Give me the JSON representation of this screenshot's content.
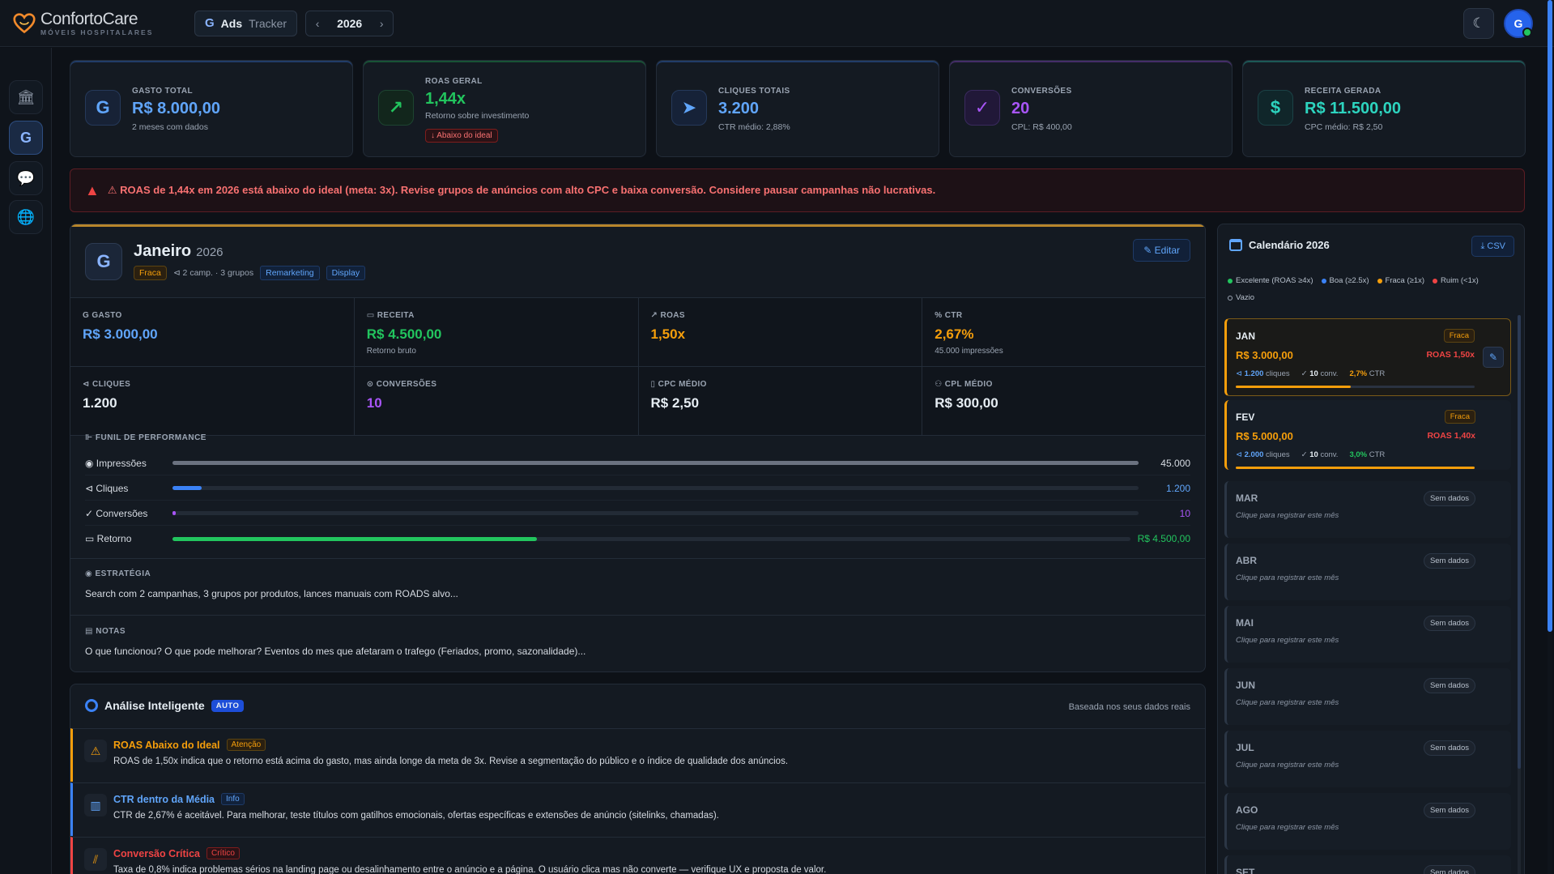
{
  "brand": {
    "name": "ConfortoCare",
    "sub": "MÓVEIS HOSPITALARES"
  },
  "app": {
    "g": "G",
    "ads": "Ads",
    "tracker": "Tracker"
  },
  "year_nav": {
    "prev": "‹",
    "year": "2026",
    "next": "›"
  },
  "user": {
    "initial": "G",
    "theme_icon": "☾"
  },
  "sidebar": {
    "items": [
      {
        "name": "hospital-icon",
        "glyph": "🏛",
        "active": false
      },
      {
        "name": "google-icon",
        "glyph": "G",
        "active": true
      },
      {
        "name": "chat-icon",
        "glyph": "💬",
        "active": false
      },
      {
        "name": "globe-icon",
        "glyph": "🌐",
        "active": false
      }
    ]
  },
  "kpis": [
    {
      "label": "GASTO TOTAL",
      "value": "R$ 8.000,00",
      "sub": "2 meses com dados",
      "icon": "G",
      "color": "#60a5fa"
    },
    {
      "label": "ROAS GERAL",
      "value": "1,44x",
      "sub": "Retorno sobre investimento",
      "badge": "↓ Abaixo do ideal",
      "icon": "↗",
      "color": "#22c55e"
    },
    {
      "label": "CLIQUES TOTAIS",
      "value": "3.200",
      "sub": "CTR médio: 2,88%",
      "icon": "➤",
      "color": "#60a5fa"
    },
    {
      "label": "CONVERSÕES",
      "value": "20",
      "sub": "CPL: R$ 400,00",
      "icon": "✓",
      "color": "#a855f7"
    },
    {
      "label": "RECEITA GERADA",
      "value": "R$ 11.500,00",
      "sub": "CPC médio: R$ 2,50",
      "icon": "$",
      "color": "#2dd4bf"
    }
  ],
  "alert": {
    "text": "⚠ ROAS de 1,44x em 2026 está abaixo do ideal (meta: 3x). Revise grupos de anúncios com alto CPC e baixa conversão. Considere pausar campanhas não lucrativas."
  },
  "month": {
    "title": "Janeiro",
    "year": "2026",
    "status": "Fraca",
    "meta": "⊲ 2 camp. · 3 grupos",
    "tags": [
      "Remarketing",
      "Display"
    ],
    "edit": "✎ Editar",
    "metrics": [
      {
        "label": "G GASTO",
        "value": "R$ 3.000,00",
        "sub": "",
        "color": "#60a5fa"
      },
      {
        "label": "▭ RECEITA",
        "value": "R$ 4.500,00",
        "sub": "Retorno bruto",
        "color": "#22c55e"
      },
      {
        "label": "↗ ROAS",
        "value": "1,50x",
        "sub": "",
        "color": "#f59e0b"
      },
      {
        "label": "% CTR",
        "value": "2,67%",
        "sub": "45.000 impressões",
        "color": "#f59e0b"
      },
      {
        "label": "⊲ CLIQUES",
        "value": "1.200",
        "sub": "",
        "color": "#e6edf3"
      },
      {
        "label": "⊙ CONVERSÕES",
        "value": "10",
        "sub": "",
        "color": "#a855f7"
      },
      {
        "label": "▯ CPC MÉDIO",
        "value": "R$ 2,50",
        "sub": "",
        "color": "#e6edf3"
      },
      {
        "label": "⚇ CPL MÉDIO",
        "value": "R$ 300,00",
        "sub": "",
        "color": "#e6edf3"
      }
    ],
    "funnel_title": "⊩ FUNIL DE PERFORMANCE",
    "funnel": [
      {
        "label": "◉ Impressões",
        "value": "45.000",
        "pct": 100,
        "color": "#6b7280",
        "vcolor": "#d6dbe2"
      },
      {
        "label": "⊲ Cliques",
        "value": "1.200",
        "pct": 3,
        "color": "#3b82f6",
        "vcolor": "#60a5fa"
      },
      {
        "label": "✓ Conversões",
        "value": "10",
        "pct": 0.3,
        "color": "#a855f7",
        "vcolor": "#a855f7"
      },
      {
        "label": "▭ Retorno",
        "value": "R$ 4.500,00",
        "pct": 38,
        "color": "#22c55e",
        "vcolor": "#22c55e"
      }
    ],
    "strategy_title": "◉ ESTRATÉGIA",
    "strategy_text": "Search com 2 campanhas, 3 grupos por produtos, lances manuais com ROADS alvo...",
    "notes_title": "▤ NOTAS",
    "notes_text": "O que funcionou? O que pode melhorar? Eventos do mes que afetaram o trafego (Feriados, promo, sazonalidade)..."
  },
  "analysis": {
    "title": "Análise Inteligente",
    "auto": "AUTO",
    "right": "Baseada nos seus dados reais",
    "items": [
      {
        "icon": "⚠",
        "title": "ROAS Abaixo do Ideal",
        "badge": "Atenção",
        "color": "#f59e0b",
        "text": "ROAS de 1,50x indica que o retorno está acima do gasto, mas ainda longe da meta de 3x. Revise a segmentação do público e o índice de qualidade dos anúncios."
      },
      {
        "icon": "▥",
        "title": "CTR dentro da Média",
        "badge": "Info",
        "color": "#3b82f6",
        "text": "CTR de 2,67% é aceitável. Para melhorar, teste títulos com gatilhos emocionais, ofertas específicas e extensões de anúncio (sitelinks, chamadas)."
      },
      {
        "icon": "⫽",
        "title": "Conversão Crítica",
        "badge": "Crítico",
        "color": "#ef4444",
        "text": "Taxa de 0,8% indica problemas sérios na landing page ou desalinhamento entre o anúncio e a página. O usuário clica mas não converte — verifique UX e proposta de valor."
      }
    ]
  },
  "calendar": {
    "title": "Calendário 2026",
    "csv": "⤓ CSV",
    "legend": [
      {
        "label": "Excelente (ROAS ≥4x)",
        "color": "#22c55e"
      },
      {
        "label": "Boa (≥2.5x)",
        "color": "#3b82f6"
      },
      {
        "label": "Fraca (≥1x)",
        "color": "#f59e0b"
      },
      {
        "label": "Ruim (<1x)",
        "color": "#ef4444"
      },
      {
        "label": "Vazio",
        "color": ""
      }
    ],
    "filled": [
      {
        "month": "JAN",
        "status": "Fraca",
        "value": "R$ 3.000,00",
        "roas": "ROAS 1,50x",
        "clicks": "1.200",
        "clicks_label": "cliques",
        "conv": "10",
        "conv_label": "conv.",
        "ctr": "2,7%",
        "ctr_label": "CTR",
        "bar": 0.48
      },
      {
        "month": "FEV",
        "status": "Fraca",
        "value": "R$ 5.000,00",
        "roas": "ROAS 1,40x",
        "clicks": "2.000",
        "clicks_label": "cliques",
        "conv": "10",
        "conv_label": "conv.",
        "ctr": "3,0%",
        "ctr_label": "CTR",
        "bar": 1
      }
    ],
    "empty": [
      {
        "month": "MAR",
        "badge": "Sem dados",
        "hint": "Clique para registrar este mês"
      },
      {
        "month": "ABR",
        "badge": "Sem dados",
        "hint": "Clique para registrar este mês"
      },
      {
        "month": "MAI",
        "badge": "Sem dados",
        "hint": "Clique para registrar este mês"
      },
      {
        "month": "JUN",
        "badge": "Sem dados",
        "hint": "Clique para registrar este mês"
      },
      {
        "month": "JUL",
        "badge": "Sem dados",
        "hint": "Clique para registrar este mês"
      },
      {
        "month": "AGO",
        "badge": "Sem dados",
        "hint": "Clique para registrar este mês"
      },
      {
        "month": "SET",
        "badge": "Sem dados",
        "hint": ""
      }
    ]
  }
}
